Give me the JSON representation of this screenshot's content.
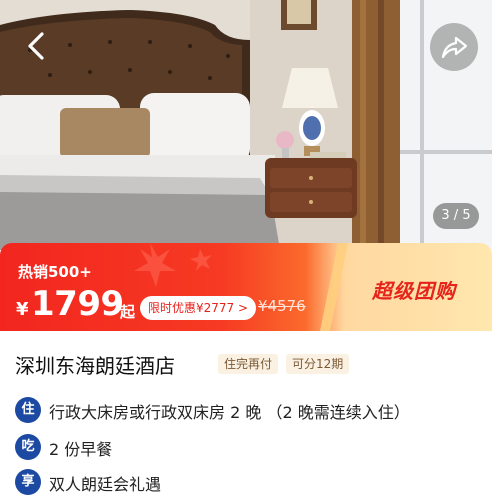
{
  "gallery": {
    "counter": "3 / 5"
  },
  "promo": {
    "hot_label": "热销500+",
    "currency": "¥",
    "price": "1799",
    "price_suffix": "起",
    "limited_offer": "限时优惠¥2777 >",
    "original_price": "¥4576",
    "campaign": "超级团购"
  },
  "hotel": {
    "name": "深圳东海朗廷酒店",
    "tags": [
      "住完再付",
      "可分12期"
    ]
  },
  "details": [
    {
      "badge": "住",
      "text": "行政大床房或行政双床房 2 晚 （2 晚需连续入住）"
    },
    {
      "badge": "吃",
      "text": "2 份早餐"
    },
    {
      "badge": "享",
      "text": "双人朗廷会礼遇"
    }
  ],
  "colors": {
    "promo_red": "#f2261f",
    "promo_gold": "#ffe7ae",
    "badge_blue": "#1c4aa2",
    "tag_bg": "#fbf1e3"
  }
}
